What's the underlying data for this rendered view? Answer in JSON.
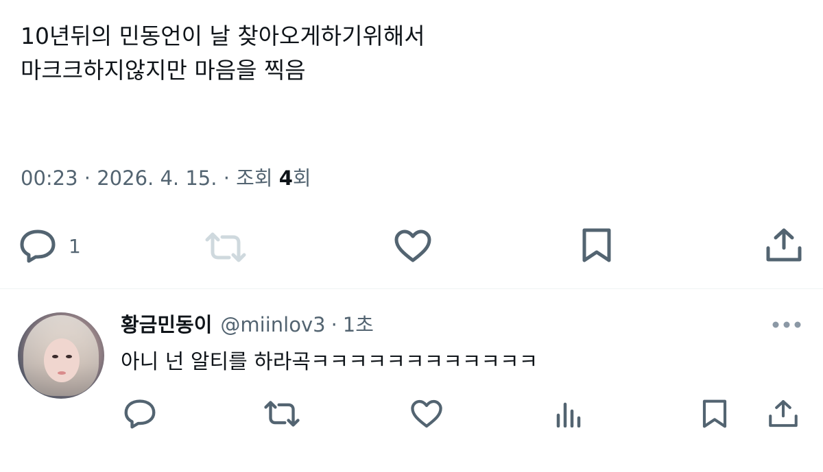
{
  "post": {
    "line1": "10년뒤의 민동언이 날 찾아오게하기위해서",
    "line2": "마크크하지않지만 마음을 찍음",
    "time": "00:23",
    "sep1": "·",
    "date": "2026. 4. 15.",
    "sep2": "·",
    "views_prefix": "조회",
    "views_count": "4",
    "views_suffix": "회",
    "actions": {
      "reply_icon": "reply-icon",
      "reply_count": "1",
      "repost_icon": "repost-icon",
      "like_icon": "heart-icon",
      "bookmark_icon": "bookmark-icon",
      "share_icon": "share-icon"
    }
  },
  "reply": {
    "name": "황금민동이",
    "handle": "@miinlov3",
    "dot": "·",
    "time": "1초",
    "text": "아니 넌 알티를 하라곡ㅋㅋㅋㅋㅋㅋㅋㅋㅋㅋㅋㅋ",
    "actions": [
      "reply-icon",
      "repost-icon",
      "heart-icon",
      "analytics-icon",
      "bookmark-icon",
      "share-icon"
    ]
  },
  "colors": {
    "text": "#0f1419",
    "secondary": "#536471",
    "divider": "#eff3f4",
    "repost_disabled": "#cfd9de"
  }
}
